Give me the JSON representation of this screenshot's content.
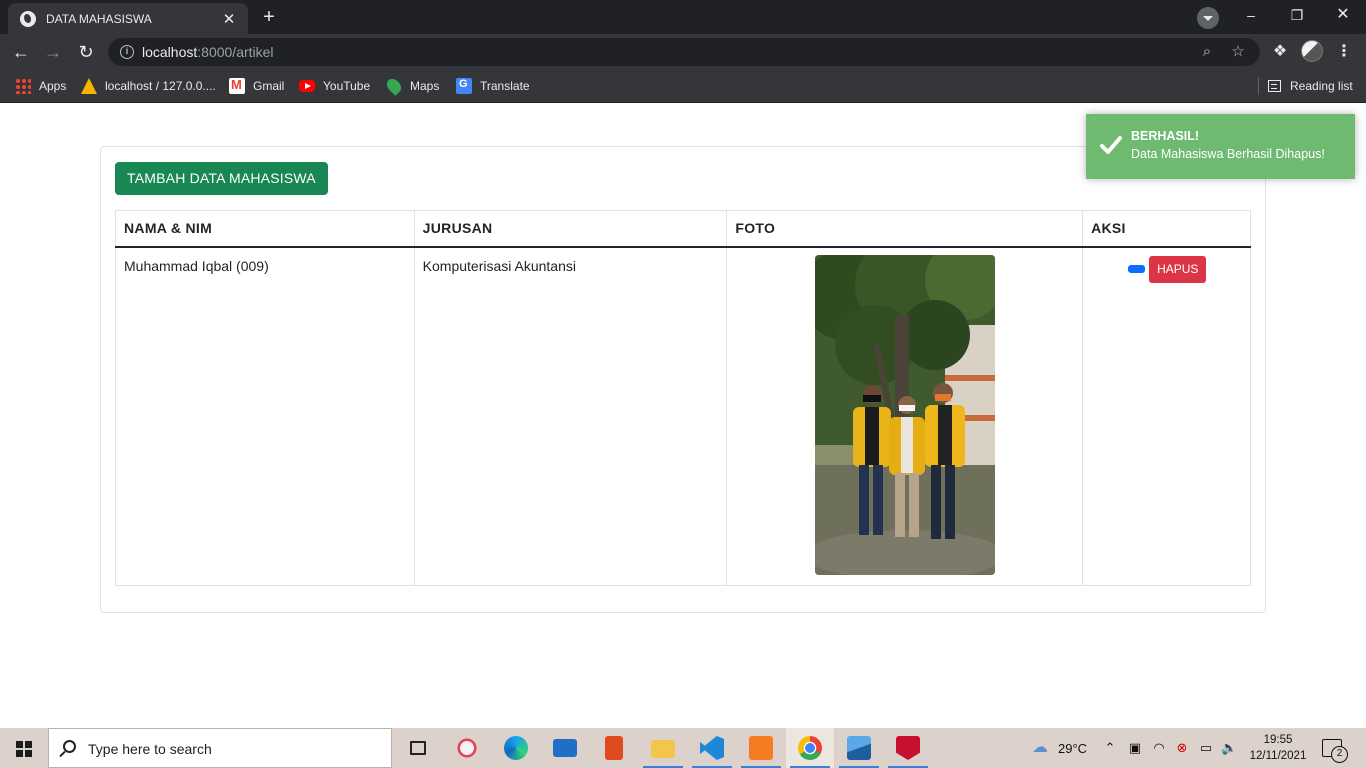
{
  "browser": {
    "tab_title": "DATA MAHASISWA",
    "tab_close": "✕",
    "new_tab": "+",
    "url_host": "localhost",
    "url_rest": ":8000/artikel",
    "bookmarks": [
      {
        "label": "Apps",
        "icon": "apps-grid-icon"
      },
      {
        "label": "localhost / 127.0.0....",
        "icon": "xampp-icon"
      },
      {
        "label": "Gmail",
        "icon": "gmail-icon"
      },
      {
        "label": "YouTube",
        "icon": "youtube-icon"
      },
      {
        "label": "Maps",
        "icon": "maps-icon"
      },
      {
        "label": "Translate",
        "icon": "translate-icon"
      }
    ],
    "reading_list": "Reading list"
  },
  "page": {
    "add_button": "TAMBAH DATA MAHASISWA",
    "table": {
      "headers": [
        "NAMA & NIM",
        "JURUSAN",
        "FOTO",
        "AKSI"
      ],
      "rows": [
        {
          "nama_nim": "Muhammad Iqbal (009)",
          "jurusan": "Komputerisasi Akuntansi",
          "delete_label": "HAPUS"
        }
      ]
    },
    "toast": {
      "title": "BERHASIL!",
      "message": "Data Mahasiswa Berhasil Dihapus!",
      "color": "#6dba70"
    },
    "colors": {
      "add_button": "#198754",
      "delete_button": "#dc3545",
      "edit_button": "#0d6efd"
    }
  },
  "taskbar": {
    "search_placeholder": "Type here to search",
    "weather": "29°C",
    "time": "19:55",
    "date": "12/11/2021",
    "notification_count": "2"
  }
}
